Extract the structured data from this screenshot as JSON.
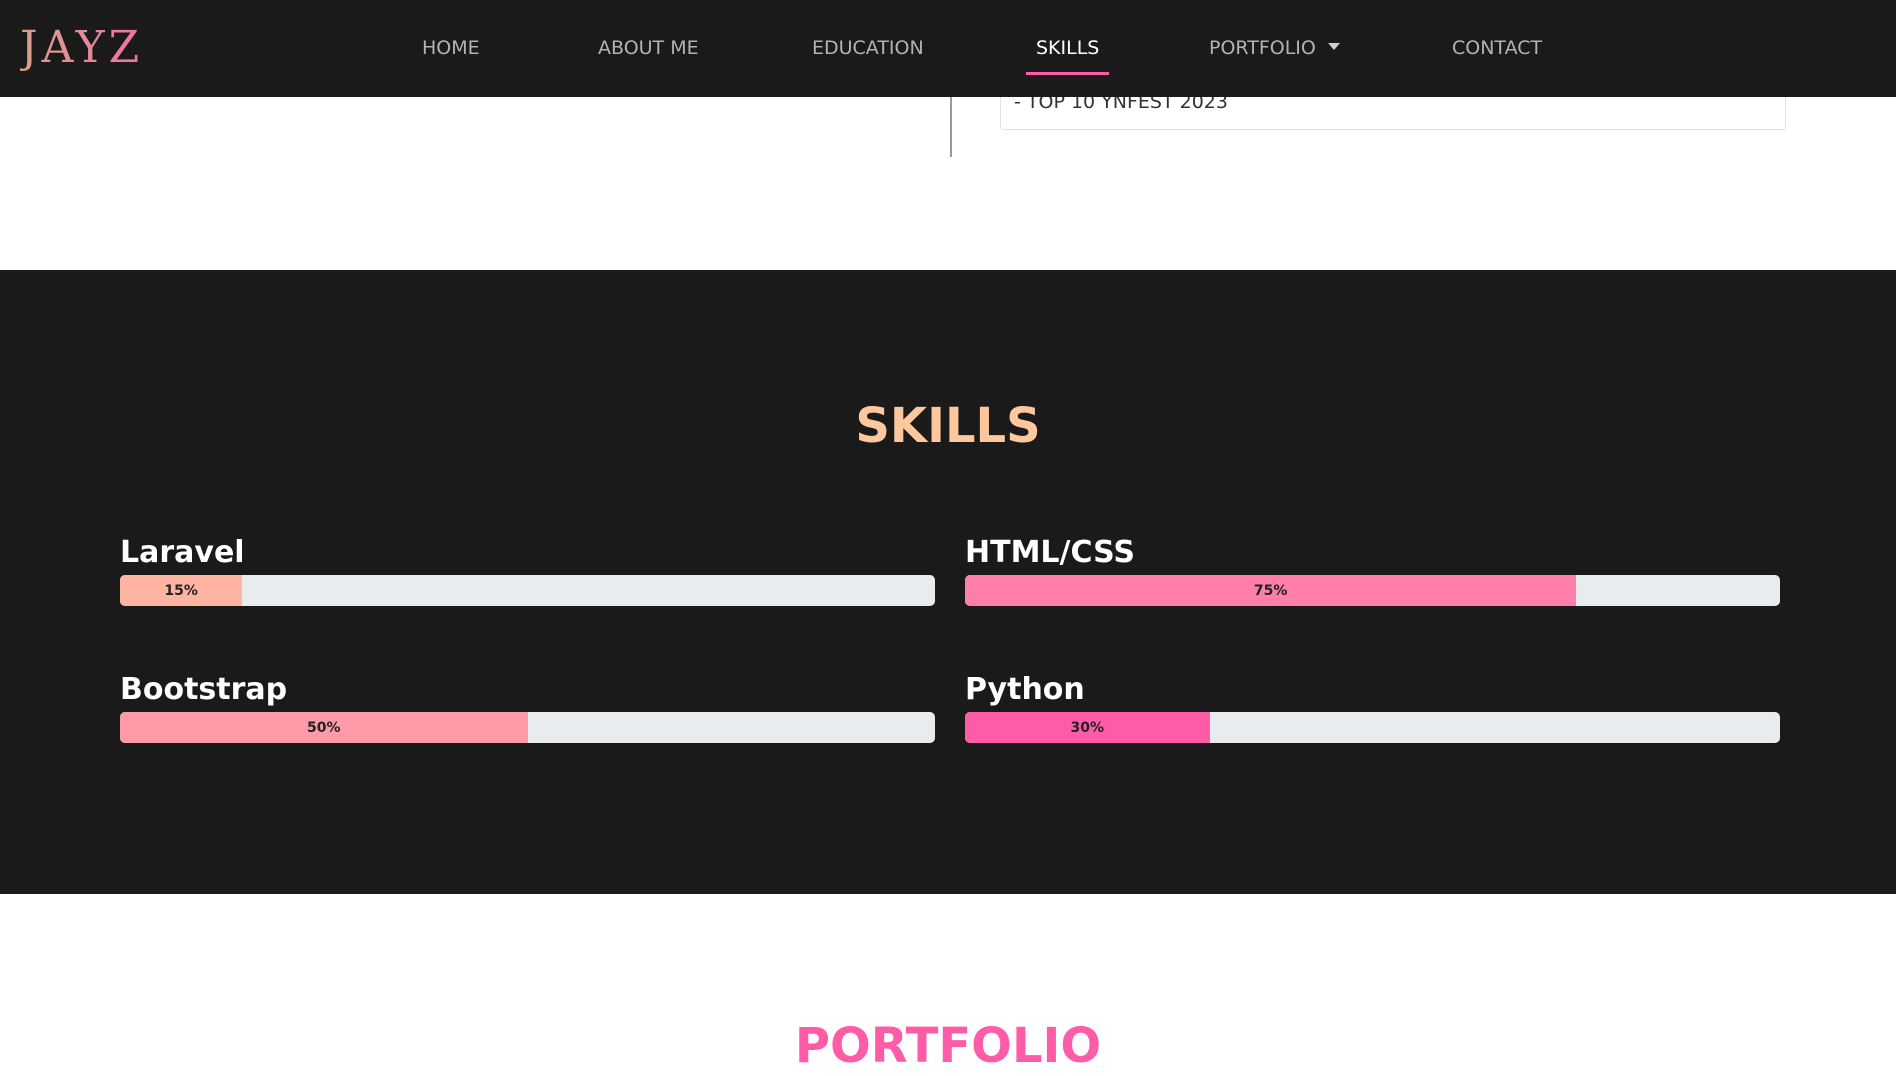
{
  "navbar": {
    "brand": "JAYZ",
    "links": [
      {
        "label": "HOME"
      },
      {
        "label": "ABOUT ME"
      },
      {
        "label": "EDUCATION"
      },
      {
        "label": "SKILLS",
        "active": true
      },
      {
        "label": "PORTFOLIO",
        "has_dropdown": true
      },
      {
        "label": "CONTACT"
      }
    ],
    "active_color": "#ff5ca8"
  },
  "education": {
    "last_item_text": "- TOP 10 YNFEST 2023"
  },
  "skills": {
    "title": "SKILLS",
    "title_color": "#ffc79e",
    "items": [
      {
        "name": "Laravel",
        "percent": 15,
        "label": "15%",
        "color": "#ffb3a1"
      },
      {
        "name": "HTML/CSS",
        "percent": 75,
        "label": "75%",
        "color": "#ff7fa8"
      },
      {
        "name": "Bootstrap",
        "percent": 50,
        "label": "50%",
        "color": "#ff9aa8"
      },
      {
        "name": "Python",
        "percent": 30,
        "label": "30%",
        "color": "#ff5ca8"
      }
    ]
  },
  "portfolio": {
    "title": "PORTFOLIO"
  }
}
